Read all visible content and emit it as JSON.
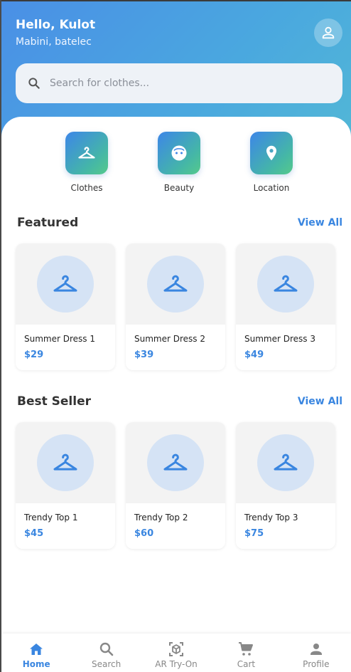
{
  "header": {
    "greeting": "Hello, Kulot",
    "location": "Mabini, batelec",
    "profile_icon": "person-icon"
  },
  "search": {
    "placeholder": "Search for clothes...",
    "value": ""
  },
  "categories": [
    {
      "label": "Clothes",
      "icon": "hanger-icon"
    },
    {
      "label": "Beauty",
      "icon": "face-icon"
    },
    {
      "label": "Location",
      "icon": "location-pin-icon"
    }
  ],
  "featured": {
    "title": "Featured",
    "view_all": "View All",
    "items": [
      {
        "name": "Summer Dress 1",
        "price": "$29"
      },
      {
        "name": "Summer Dress 2",
        "price": "$39"
      },
      {
        "name": "Summer Dress 3",
        "price": "$49"
      }
    ]
  },
  "best_seller": {
    "title": "Best Seller",
    "view_all": "View All",
    "items": [
      {
        "name": "Trendy Top 1",
        "price": "$45"
      },
      {
        "name": "Trendy Top 2",
        "price": "$60"
      },
      {
        "name": "Trendy Top 3",
        "price": "$75"
      }
    ]
  },
  "bottom_nav": {
    "items": [
      {
        "label": "Home",
        "icon": "home-icon",
        "active": true
      },
      {
        "label": "Search",
        "icon": "search-icon",
        "active": false
      },
      {
        "label": "AR Try-On",
        "icon": "ar-cube-icon",
        "active": false
      },
      {
        "label": "Cart",
        "icon": "cart-icon",
        "active": false
      },
      {
        "label": "Profile",
        "icon": "person-icon",
        "active": false
      }
    ]
  },
  "colors": {
    "accent": "#3a86e0",
    "header_gradient_start": "#4a8fe6",
    "header_gradient_end": "#52b7d6",
    "tile_gradient_start": "#3d86e8",
    "tile_gradient_end": "#55c98b",
    "placeholder_circle": "#d5e3f5",
    "nav_inactive": "#888888"
  }
}
